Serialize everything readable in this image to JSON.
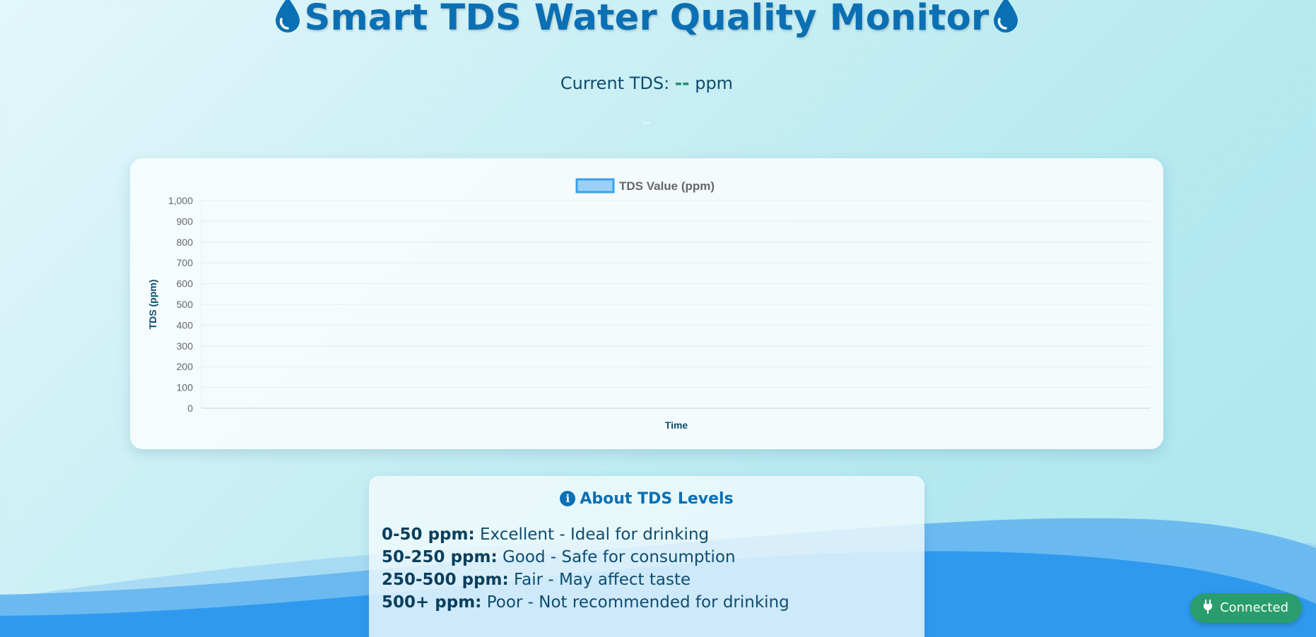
{
  "header": {
    "title": "Smart TDS Water Quality Monitor",
    "icon": "water-drop-icon"
  },
  "reading": {
    "label": "Current TDS:",
    "value": "--",
    "unit": "ppm",
    "status": "--"
  },
  "chart_data": {
    "type": "line",
    "title": "",
    "legend": [
      "TDS Value (ppm)"
    ],
    "legend_position": "top",
    "xlabel": "Time",
    "ylabel": "TDS (ppm)",
    "ylim": [
      0,
      1000
    ],
    "y_ticks": [
      "0",
      "100",
      "200",
      "300",
      "400",
      "500",
      "600",
      "700",
      "800",
      "900",
      "1,000"
    ],
    "series": [
      {
        "name": "TDS Value (ppm)",
        "values": [],
        "color": "#36a2eb",
        "fill": "#9ad0f5"
      }
    ],
    "x": [],
    "grid": true
  },
  "about": {
    "title": "About TDS Levels",
    "icon": "info-icon",
    "levels": [
      {
        "range": "0-50 ppm:",
        "desc": "Excellent - Ideal for drinking"
      },
      {
        "range": "50-250 ppm:",
        "desc": "Good - Safe for consumption"
      },
      {
        "range": "250-500 ppm:",
        "desc": "Fair - May affect taste"
      },
      {
        "range": "500+ ppm:",
        "desc": "Poor - Not recommended for drinking"
      }
    ]
  },
  "connection": {
    "label": "Connected",
    "icon": "plug-icon",
    "color": "#2a9d6f"
  },
  "colors": {
    "accent": "#0b6fb3",
    "wave": "#2196f3"
  }
}
